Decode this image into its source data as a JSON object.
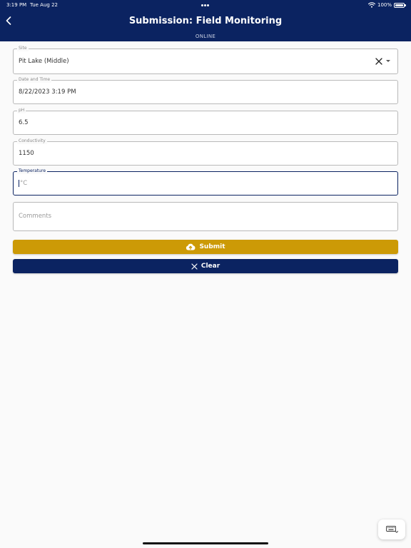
{
  "status_bar": {
    "time": "3:19 PM",
    "date": "Tue Aug 22",
    "battery": "100%",
    "battery_level": 1.0
  },
  "header": {
    "title": "Submission: Field Monitoring",
    "connection_status": "ONLINE"
  },
  "form": {
    "site": {
      "label": "Site",
      "value": "Pit Lake (Middle)"
    },
    "date_time": {
      "label": "Date and Time",
      "value": "8/22/2023 3:19 PM"
    },
    "ph": {
      "label": "pH",
      "value": "6.5"
    },
    "conductivity": {
      "label": "Conductivity",
      "value": "1150"
    },
    "temperature": {
      "label": "Temperature",
      "value": "",
      "placeholder": "°C"
    },
    "comments": {
      "placeholder": "Comments"
    }
  },
  "actions": {
    "submit_label": "Submit",
    "clear_label": "Clear"
  },
  "colors": {
    "header_bg": "#0b2361",
    "submit_bg": "#cc9a06",
    "clear_bg": "#0b2361"
  },
  "icons": {
    "back": "chevron-left-icon",
    "upload": "cloud-upload-icon",
    "clear": "close-icon",
    "keyboard": "keyboard-icon"
  }
}
